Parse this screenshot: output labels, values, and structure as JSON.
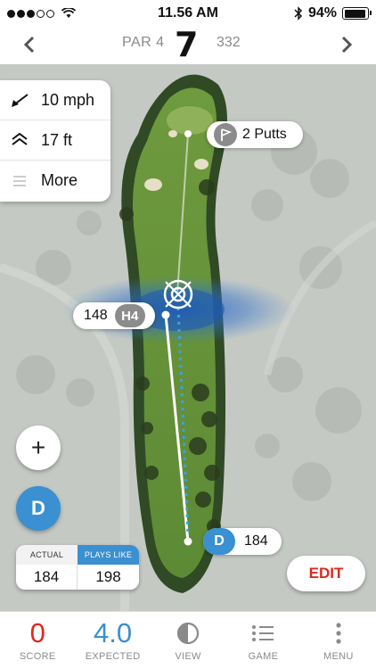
{
  "status_bar": {
    "time": "11.56 AM",
    "battery": "94%",
    "battery_level": 0.94
  },
  "hole": {
    "par": "PAR 4",
    "number": "7",
    "yards": "332"
  },
  "conditions": {
    "wind": "10 mph",
    "elevation": "17 ft",
    "more_label": "More"
  },
  "labels": {
    "putts": "2 Putts",
    "target_distance": "148",
    "target_club": "H4",
    "tee_club": "D",
    "tee_distance": "184"
  },
  "controls": {
    "add": "+",
    "club_button": "D",
    "edit": "EDIT"
  },
  "distance_card": {
    "actual_label": "ACTUAL",
    "actual_value": "184",
    "plays_like_label": "PLAYS LIKE",
    "plays_like_value": "198"
  },
  "tabbar": {
    "score_value": "0",
    "score_label": "SCORE",
    "expected_value": "4.0",
    "expected_label": "EXPECTED",
    "view_label": "VIEW",
    "game_label": "GAME",
    "menu_label": "MENU"
  },
  "colors": {
    "accent_blue": "#3a90d0",
    "score_red": "#e0281e",
    "fairway_green": "#6f9a3e"
  }
}
